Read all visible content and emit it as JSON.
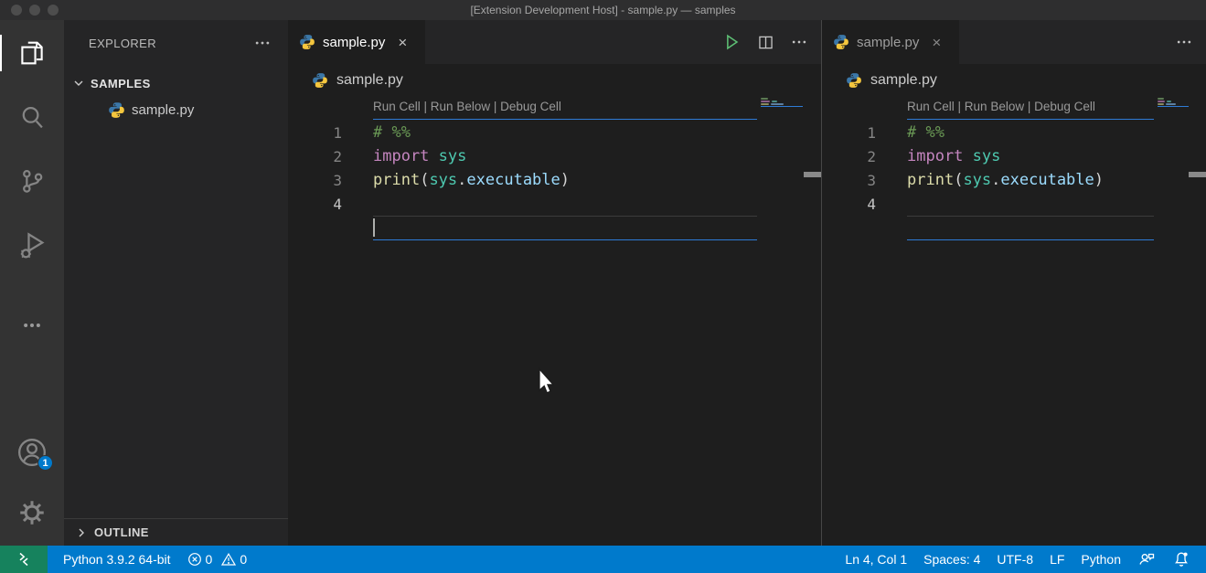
{
  "window": {
    "title": "[Extension Development Host] - sample.py — samples"
  },
  "activity_bar": {
    "items": [
      {
        "icon": "files-icon",
        "active": true
      },
      {
        "icon": "search-icon"
      },
      {
        "icon": "source-control-icon"
      },
      {
        "icon": "run-debug-icon"
      },
      {
        "icon": "more-views-icon"
      },
      {
        "icon": "accounts-icon",
        "badge": "1"
      },
      {
        "icon": "settings-gear-icon"
      }
    ]
  },
  "sidebar": {
    "title": "EXPLORER",
    "section": {
      "label": "SAMPLES",
      "chevron": "expanded"
    },
    "file": {
      "label": "sample.py",
      "icon": "python-icon"
    },
    "outline": {
      "label": "OUTLINE",
      "chevron": "collapsed"
    }
  },
  "editor": {
    "tab": {
      "label": "sample.py",
      "icon": "python-icon",
      "close": "×"
    },
    "breadcrumb": "sample.py",
    "codelens": {
      "links": [
        "Run Cell",
        "Run Below",
        "Debug Cell"
      ],
      "separator": " | "
    },
    "lines": [
      {
        "num": "1",
        "tokens": [
          {
            "text": "# %%",
            "color": "#6A9955",
            "italic": true
          }
        ]
      },
      {
        "num": "2",
        "tokens": [
          {
            "text": "import ",
            "color": "#C586C0"
          },
          {
            "text": "sys",
            "color": "#4EC9B0"
          }
        ]
      },
      {
        "num": "3",
        "tokens": [
          {
            "text": "print",
            "color": "#DCDCAA"
          },
          {
            "text": "(",
            "color": "#D4D4D4"
          },
          {
            "text": "sys",
            "color": "#4EC9B0"
          },
          {
            "text": ".",
            "color": "#D4D4D4"
          },
          {
            "text": "executable",
            "color": "#9CDCFE"
          },
          {
            "text": ")",
            "color": "#D4D4D4"
          }
        ]
      },
      {
        "num": "4",
        "tokens": [],
        "active": true
      }
    ],
    "colors": {
      "cell_border": "#2e7bd6",
      "line_number": "#858585",
      "active_line_number": "#c6c6c6"
    }
  },
  "editor_actions": {
    "group1": [
      "run-python-file-icon",
      "split-editor-icon",
      "ellipsis-icon"
    ],
    "group2": [
      "ellipsis-icon"
    ]
  },
  "status_bar": {
    "colors": {
      "background": "#007acc",
      "remote_background": "#16825d"
    },
    "remote_icon": "remote-icon",
    "interpreter": "Python 3.9.2 64-bit",
    "problems": {
      "errors": "0",
      "warnings": "0"
    },
    "right": {
      "cursor_position": "Ln 4, Col 1",
      "indentation": "Spaces: 4",
      "encoding": "UTF-8",
      "eol": "LF",
      "language": "Python"
    }
  }
}
